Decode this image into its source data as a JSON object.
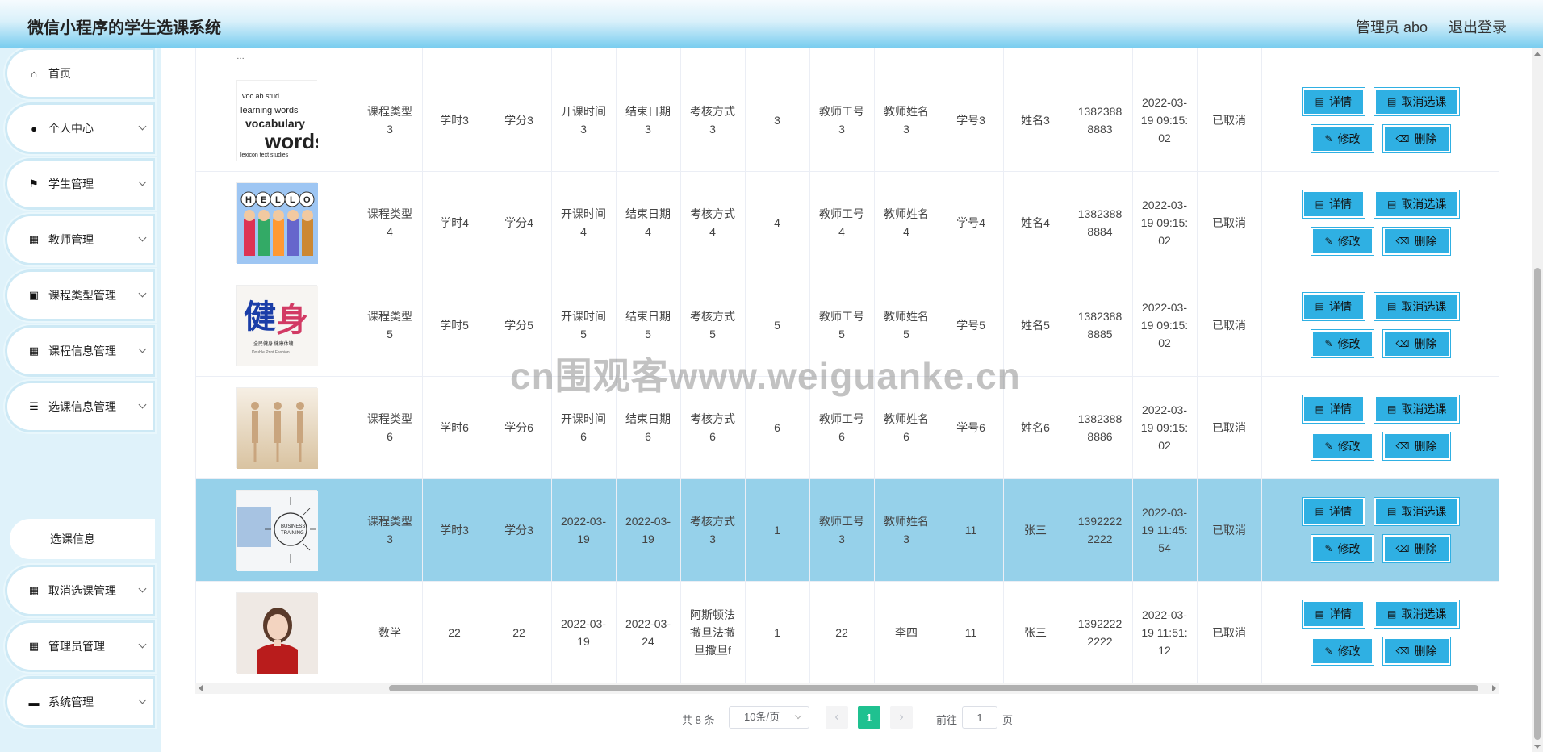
{
  "header": {
    "title": "微信小程序的学生选课系统",
    "user": "管理员 abo",
    "logout": "退出登录"
  },
  "sidebar": {
    "items": [
      {
        "label": "首页",
        "icon": "home-icon"
      },
      {
        "label": "个人中心",
        "icon": "user-icon"
      },
      {
        "label": "学生管理",
        "icon": "flag-icon"
      },
      {
        "label": "教师管理",
        "icon": "grid-icon"
      },
      {
        "label": "课程类型管理",
        "icon": "clipboard-icon"
      },
      {
        "label": "课程信息管理",
        "icon": "grid-icon"
      },
      {
        "label": "选课信息管理",
        "icon": "list-icon"
      },
      {
        "label": "取消选课管理",
        "icon": "grid-icon"
      },
      {
        "label": "管理员管理",
        "icon": "grid-icon"
      },
      {
        "label": "系统管理",
        "icon": "briefcase-icon"
      }
    ],
    "subitem": "选课信息"
  },
  "table": {
    "top_partial": "…",
    "rows": [
      {
        "img": "words",
        "type": "课程类型3",
        "hours": "学时3",
        "credits": "学分3",
        "start": "开课时间3",
        "end": "结束日期3",
        "exam": "考核方式3",
        "num": "3",
        "tid": "教师工号3",
        "tname": "教师姓名3",
        "sid": "学号3",
        "sname": "姓名3",
        "phone": "13823888883",
        "time": "2022-03-19 09:15:02",
        "status": "已取消"
      },
      {
        "img": "hello",
        "type": "课程类型4",
        "hours": "学时4",
        "credits": "学分4",
        "start": "开课时间4",
        "end": "结束日期4",
        "exam": "考核方式4",
        "num": "4",
        "tid": "教师工号4",
        "tname": "教师姓名4",
        "sid": "学号4",
        "sname": "姓名4",
        "phone": "13823888884",
        "time": "2022-03-19 09:15:02",
        "status": "已取消"
      },
      {
        "img": "fitness",
        "type": "课程类型5",
        "hours": "学时5",
        "credits": "学分5",
        "start": "开课时间5",
        "end": "结束日期5",
        "exam": "考核方式5",
        "num": "5",
        "tid": "教师工号5",
        "tname": "教师姓名5",
        "sid": "学号5",
        "sname": "姓名5",
        "phone": "13823888885",
        "time": "2022-03-19 09:15:02",
        "status": "已取消"
      },
      {
        "img": "yoga",
        "type": "课程类型6",
        "hours": "学时6",
        "credits": "学分6",
        "start": "开课时间6",
        "end": "结束日期6",
        "exam": "考核方式6",
        "num": "6",
        "tid": "教师工号6",
        "tname": "教师姓名6",
        "sid": "学号6",
        "sname": "姓名6",
        "phone": "13823888886",
        "time": "2022-03-19 09:15:02",
        "status": "已取消"
      },
      {
        "img": "business",
        "type": "课程类型3",
        "hours": "学时3",
        "credits": "学分3",
        "start": "2022-03-19",
        "end": "2022-03-19",
        "exam": "考核方式3",
        "num": "1",
        "tid": "教师工号3",
        "tname": "教师姓名3",
        "sid": "11",
        "sname": "张三",
        "phone": "13922222222",
        "time": "2022-03-19 11:45:54",
        "status": "已取消",
        "highlight": true
      },
      {
        "img": "portrait",
        "type": "数学",
        "hours": "22",
        "credits": "22",
        "start": "2022-03-19",
        "end": "2022-03-24",
        "exam": "阿斯顿法撒旦法撒旦撒旦f",
        "num": "1",
        "tid": "22",
        "tname": "李四",
        "sid": "11",
        "sname": "张三",
        "phone": "13922222222",
        "time": "2022-03-19 11:51:12",
        "status": "已取消"
      }
    ],
    "ops": {
      "detail": "详情",
      "cancel": "取消选课",
      "edit": "修改",
      "delete": "删除"
    }
  },
  "pagination": {
    "total": "共 8 条",
    "page_size": "10条/页",
    "current": "1",
    "goto": "前往",
    "page_unit": "页",
    "jump_value": "1"
  },
  "watermark": "cn围观客www.weiguanke.cn",
  "colors": {
    "accent": "#2fb0e3",
    "highlight_row": "#96d1ea",
    "pager_active": "#1fc190",
    "header_gradient_end": "#79cdef"
  }
}
